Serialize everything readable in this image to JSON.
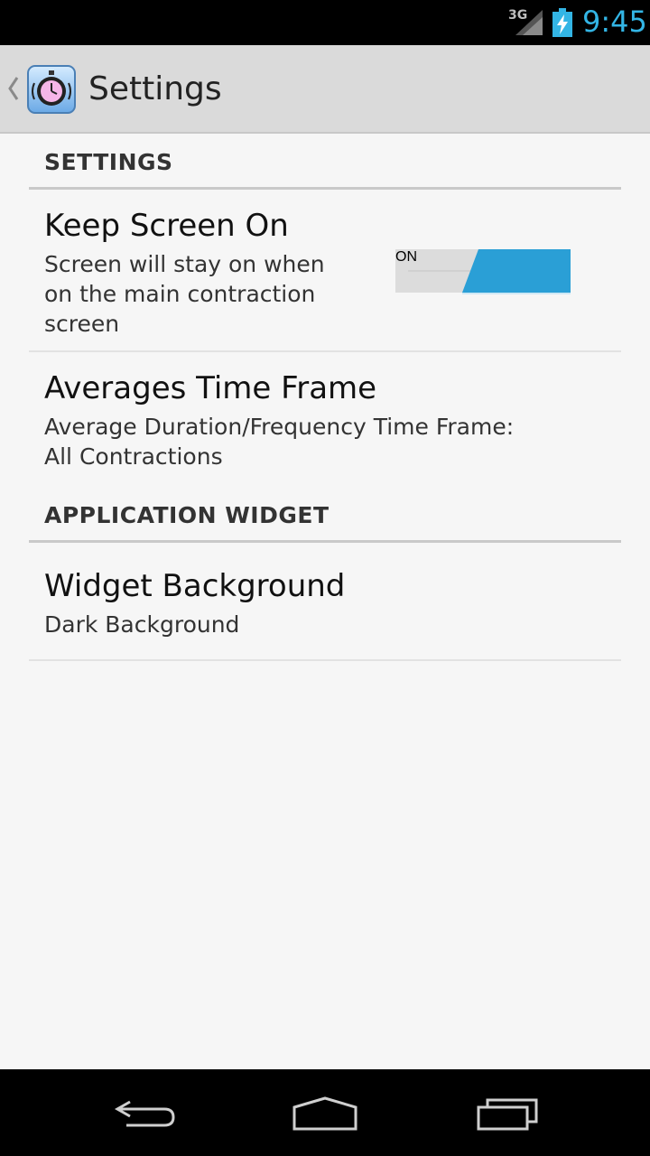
{
  "status_bar": {
    "network": "3G",
    "time": "9:45",
    "icons": [
      "signal-icon",
      "battery-charging-icon"
    ]
  },
  "action_bar": {
    "title": "Settings",
    "icons": [
      "up-caret-icon",
      "stopwatch-app-icon"
    ]
  },
  "sections": [
    {
      "header": "SETTINGS",
      "items": [
        {
          "title": "Keep Screen On",
          "summary": "Screen will stay on when\non the main contraction\nscreen",
          "switch": {
            "state_label": "ON",
            "on": true
          }
        },
        {
          "title": "Averages Time Frame",
          "summary": "Average Duration/Frequency Time Frame:\nAll Contractions"
        }
      ]
    },
    {
      "header": "APPLICATION WIDGET",
      "items": [
        {
          "title": "Widget Background",
          "summary": "Dark Background"
        }
      ]
    }
  ],
  "nav_bar": {
    "icons": [
      "back-icon",
      "home-icon",
      "recent-apps-icon"
    ]
  },
  "colors": {
    "accent": "#33b5e5",
    "switch_on": "#2a9fd6",
    "background": "#f6f6f6",
    "action_bar": "#dadada"
  }
}
